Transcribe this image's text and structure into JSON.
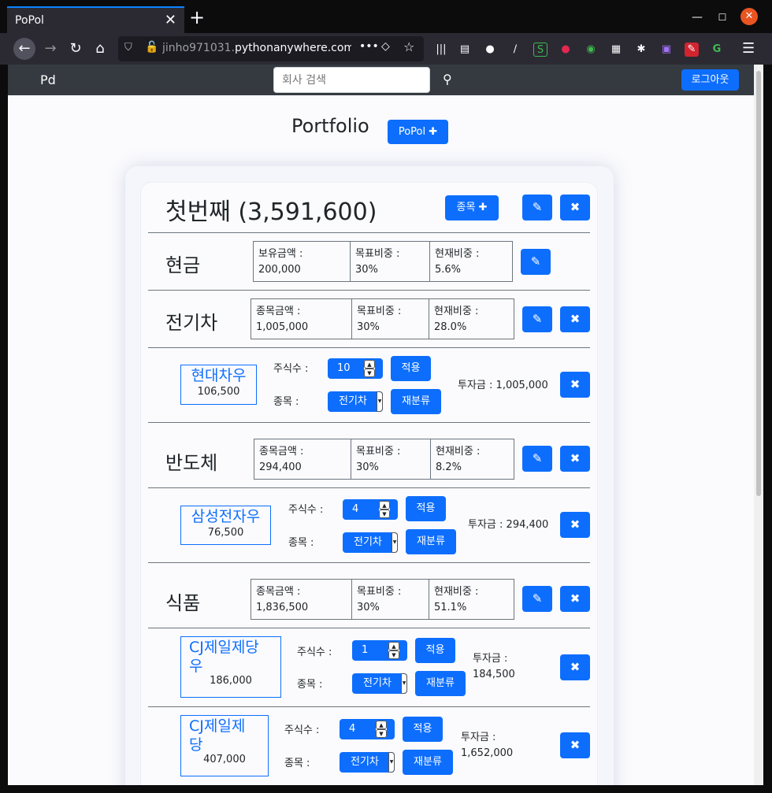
{
  "browser": {
    "tab_title": "PoPol",
    "tab_close": "✕",
    "new_tab": "+",
    "url_host": "jinho971031.",
    "url_domain": "pythonanywhere.com",
    "window_min": "—",
    "window_max": "☐",
    "window_close": "✕"
  },
  "site": {
    "brand": "Pd",
    "search_placeholder": "회사 검색",
    "logout_label": "로그아웃"
  },
  "page": {
    "title": "Portfolio",
    "add_portfolio_label": "PoPol ✚"
  },
  "portfolio": {
    "title": "첫번째 (3,591,600)",
    "add_stock_label": "종목 ✚",
    "edit_icon": "✎",
    "delete_icon": "✖",
    "cash": {
      "name": "현금",
      "held_label": "보유금액 :",
      "held_value": "200,000",
      "target_label": "목표비중 :",
      "target_value": "30%",
      "current_label": "현재비중 :",
      "current_value": "5.6%"
    },
    "categories": [
      {
        "name": "전기차",
        "amount_label": "종목금액 :",
        "amount_value": "1,005,000",
        "target_label": "목표비중 :",
        "target_value": "30%",
        "current_label": "현재비중 :",
        "current_value": "28.0%",
        "stocks": [
          {
            "name": "현대차우",
            "price": "106,500",
            "shares_label": "주식수 :",
            "shares": "10",
            "apply_label": "적용",
            "category_label": "종목 :",
            "category_value": "전기차",
            "reclassify_label": "재분류",
            "invest_label": "투자금 :",
            "invest_value": "1,005,000"
          }
        ]
      },
      {
        "name": "반도체",
        "amount_label": "종목금액 :",
        "amount_value": "294,400",
        "target_label": "목표비중 :",
        "target_value": "30%",
        "current_label": "현재비중 :",
        "current_value": "8.2%",
        "stocks": [
          {
            "name": "삼성전자우",
            "price": "76,500",
            "shares_label": "주식수 :",
            "shares": "4",
            "apply_label": "적용",
            "category_label": "종목 :",
            "category_value": "전기차",
            "reclassify_label": "재분류",
            "invest_label": "투자금 :",
            "invest_value": "294,400"
          }
        ]
      },
      {
        "name": "식품",
        "amount_label": "종목금액 :",
        "amount_value": "1,836,500",
        "target_label": "목표비중 :",
        "target_value": "30%",
        "current_label": "현재비중 :",
        "current_value": "51.1%",
        "stocks": [
          {
            "name_line1": "CJ제일제당",
            "name_line2": "우",
            "price": "186,000",
            "shares_label": "주식수 :",
            "shares": "1",
            "apply_label": "적용",
            "category_label": "종목 :",
            "category_value": "전기차",
            "reclassify_label": "재분류",
            "invest_label": "투자금 :",
            "invest_value": "184,500"
          },
          {
            "name_line1": "CJ제일제",
            "name_line2": "당",
            "price": "407,000",
            "shares_label": "주식수 :",
            "shares": "4",
            "apply_label": "적용",
            "category_label": "종목 :",
            "category_value": "전기차",
            "reclassify_label": "재분류",
            "invest_label": "투자금 :",
            "invest_value": "1,652,000"
          }
        ]
      }
    ]
  },
  "colors": {
    "primary": "#0d6efd",
    "navbar": "#343a40",
    "browser_dark": "#2b2a33"
  }
}
